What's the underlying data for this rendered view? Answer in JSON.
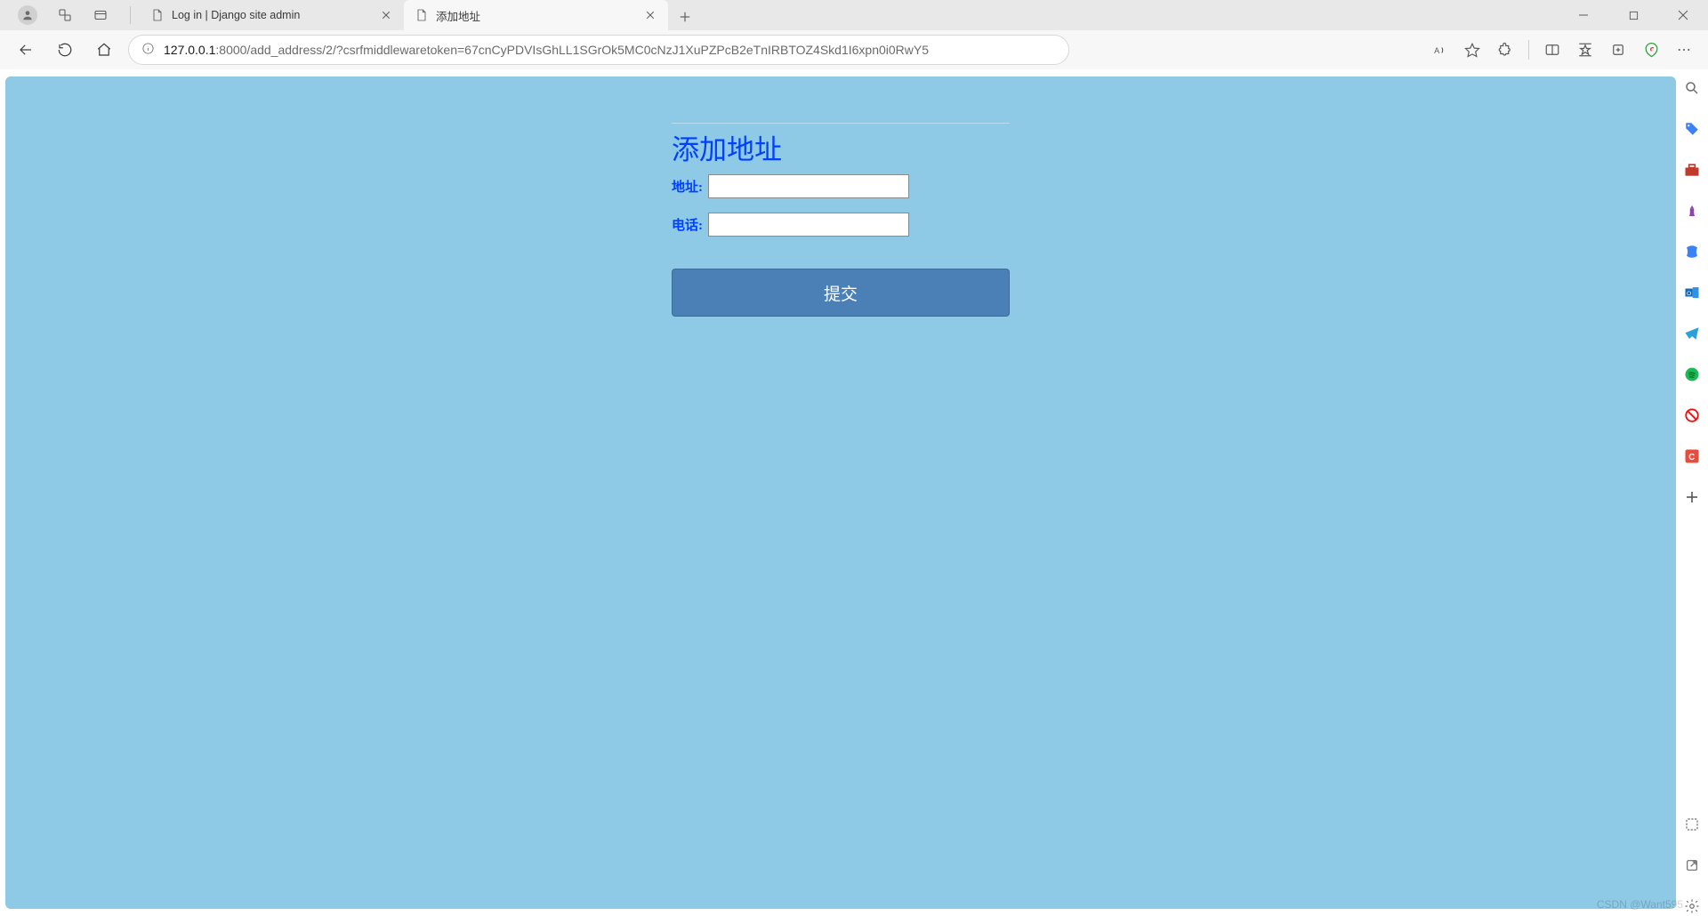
{
  "window": {
    "minimize": "−",
    "maximize": "□",
    "close": "✕"
  },
  "tabs": [
    {
      "title": "Log in | Django site admin",
      "active": false
    },
    {
      "title": "添加地址",
      "active": true
    }
  ],
  "addressbar": {
    "host": "127.0.0.1",
    "path": ":8000/add_address/2/?csrfmiddlewaretoken=67cnCyPDVIsGhLL1SGrOk5MC0cNzJ1XuPZPcB2eTnIRBTOZ4Skd1I6xpn0i0RwY5"
  },
  "toolbar_icons": {
    "back": "back-icon",
    "forward": "forward-icon",
    "refresh": "refresh-icon",
    "home": "home-icon",
    "read_aloud": "read-aloud-icon",
    "favorite": "star-icon",
    "extensions": "puzzle-icon",
    "split": "split-screen-icon",
    "favorites_bar": "favorites-icon",
    "collections": "collections-icon",
    "performance": "performance-icon",
    "more": "more-icon"
  },
  "page": {
    "heading": "添加地址",
    "field_address_label": "地址:",
    "field_phone_label": "电话:",
    "field_address_value": "",
    "field_phone_value": "",
    "submit_label": "提交"
  },
  "siderail": {
    "items": [
      "search",
      "tag",
      "toolbox",
      "chess",
      "office",
      "outlook",
      "telegram",
      "spotify",
      "noentry",
      "app-c"
    ],
    "add": "+"
  },
  "watermark": "CSDN @Want595"
}
